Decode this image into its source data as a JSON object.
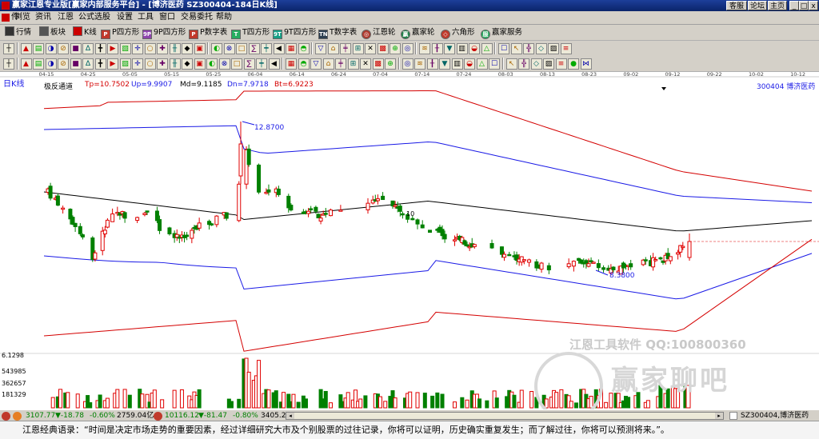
{
  "window": {
    "title": "赢家江恩专业版[赢家内部服务平台] - [博济医药   SZ300404-184日K线]",
    "buttons": [
      "客服",
      "论坛",
      "主页"
    ],
    "controls": [
      "_",
      "□",
      "x"
    ]
  },
  "menu": [
    "文件",
    "浏览",
    "资讯",
    "江恩",
    "公式选股",
    "设置",
    "工具",
    "窗口",
    "交易委托",
    "帮助"
  ],
  "toolbar1": [
    {
      "icon": "行",
      "label": "行情"
    },
    {
      "icon": "板",
      "label": "板块"
    },
    {
      "icon": "K",
      "label": "K线"
    },
    {
      "icon": "P",
      "label": "P四方形"
    },
    {
      "icon": "9P",
      "label": "9P四方形"
    },
    {
      "icon": "P",
      "label": "P数字表"
    },
    {
      "icon": "T",
      "label": "T四方形"
    },
    {
      "icon": "9T",
      "label": "9T四方形"
    },
    {
      "icon": "TN",
      "label": "T数字表"
    },
    {
      "icon": "◎",
      "label": "江恩轮"
    },
    {
      "icon": "赢",
      "label": "赢家轮"
    },
    {
      "icon": "◇",
      "label": "六角形"
    },
    {
      "icon": "服",
      "label": "赢家服务"
    }
  ],
  "toolbar2_icons": 44,
  "toolbar3_icons": 46,
  "chart": {
    "period_label": "日K线",
    "indicator": {
      "name": "极反通道",
      "tp": "Tp=10.7502",
      "up": "Up=9.9907",
      "md": "Md=9.1185",
      "dn": "Dn=7.9718",
      "bt": "Bt=6.9223"
    },
    "stock": "300404  博济医药",
    "dates": [
      "04-15",
      "04-25",
      "05-05",
      "05-15",
      "05-25",
      "06-04",
      "06-14",
      "06-24",
      "07-04",
      "07-14",
      "07-24",
      "08-03",
      "08-13",
      "08-23",
      "09-02",
      "09-12",
      "09-22",
      "10-02",
      "10-12"
    ],
    "high_label": "12.8700",
    "low_label": "8.3800",
    "mark_10": "10",
    "vol_labels": [
      "6.1298",
      "543985",
      "362657",
      "181329"
    ],
    "colors": {
      "up": "#e00000",
      "down": "#008000",
      "tp": "#d40000",
      "up_band": "#1a1ae6",
      "md": "#000000"
    }
  },
  "watermark": {
    "line1": "江恩工具软件  QQ:100800360",
    "line2": "赢家聊吧"
  },
  "status": {
    "sh_index": "3107.77",
    "sh_change": "▼-18.78",
    "sh_pct": "-0.60%",
    "sh_amount": "2759.04亿",
    "sz_index": "10116.12",
    "sz_change": "▼-81.47",
    "sz_pct": "-0.80%",
    "sz_amount": "3405.2",
    "right": "SZ300404,博济医药"
  },
  "quote": "江恩经典语录：“时间是决定市场走势的重要因素，经过详细研究大市及个别股票的过往记录，你将可以证明，历史确实重复发生；而了解过往，你将可以预测将来。”。"
}
